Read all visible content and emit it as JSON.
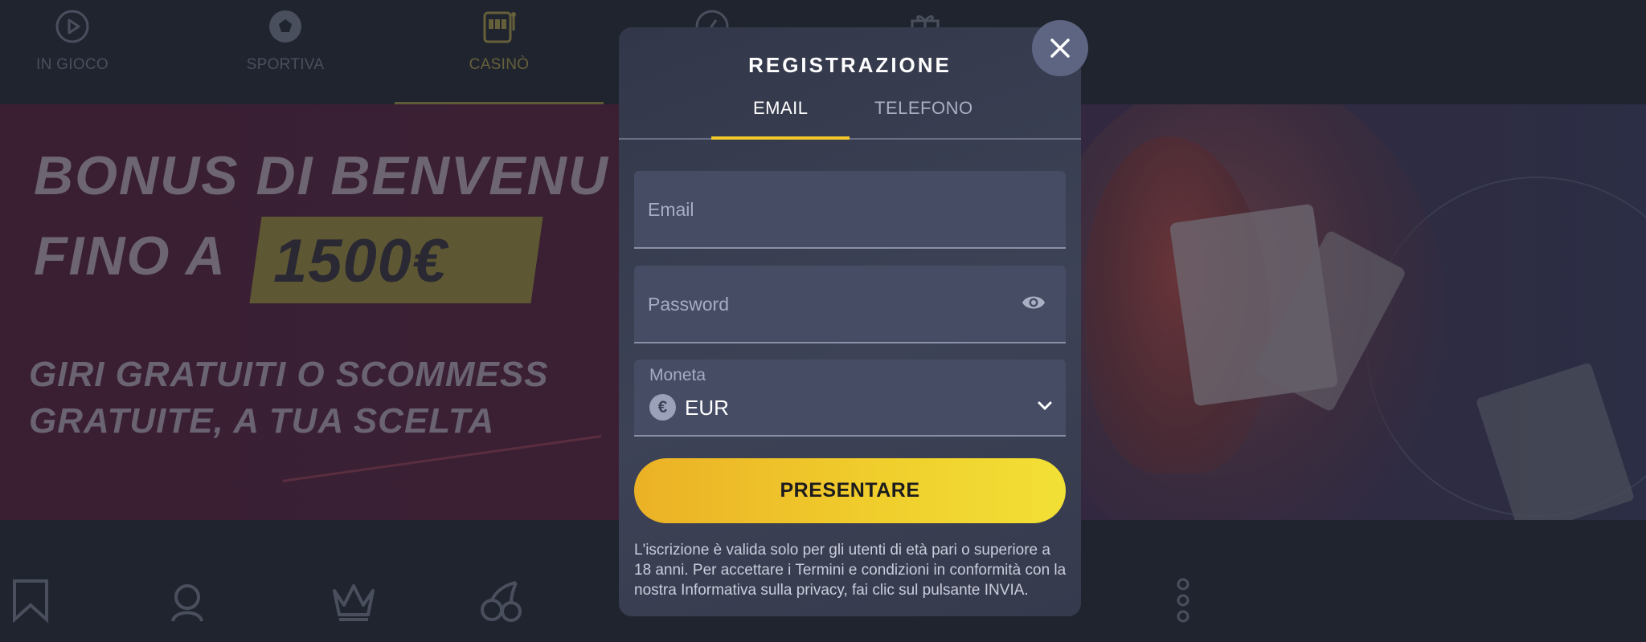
{
  "topnav": {
    "items": [
      {
        "label": "IN GIOCO",
        "icon": "play-circle-icon"
      },
      {
        "label": "SPORTIVA",
        "icon": "soccer-ball-icon"
      },
      {
        "label": "CASINÒ",
        "icon": "slot-machine-icon",
        "active": true
      },
      {
        "label": "",
        "icon": "rocket-icon"
      },
      {
        "label": "",
        "icon": "gift-icon"
      }
    ]
  },
  "banner": {
    "line1": "BONUS DI BENVENU",
    "line2": "FINO A",
    "amount": "1500€",
    "line3": "GIRI GRATUITI O SCOMMESS",
    "line4": "GRATUITE, A TUA SCELTA"
  },
  "bottomnav": {
    "icons": [
      "bookmark-icon",
      "support-agent-icon",
      "crown-icon",
      "cherries-icon",
      "more-vertical-icon"
    ]
  },
  "modal": {
    "title": "REGISTRAZIONE",
    "close_icon": "close-icon",
    "tabs": [
      {
        "label": "EMAIL",
        "active": true
      },
      {
        "label": "TELEFONO",
        "active": false
      }
    ],
    "email": {
      "placeholder": "Email",
      "value": ""
    },
    "password": {
      "placeholder": "Password",
      "value": "",
      "toggle_icon": "eye-icon"
    },
    "currency": {
      "label": "Moneta",
      "symbol": "€",
      "value": "EUR",
      "icon": "chevron-down-icon"
    },
    "submit_label": "PRESENTARE",
    "disclaimer": "L'iscrizione è valida solo per gli utenti di età pari o superiore a 18 anni. Per accettare i Termini e condizioni in conformità con la nostra Informativa sulla privacy, fai clic sul pulsante INVIA."
  },
  "colors": {
    "accent": "#f3c82b",
    "modal_bg": "#3d4256",
    "field_bg": "#464c64",
    "overlay_bg": "#1e2231"
  }
}
